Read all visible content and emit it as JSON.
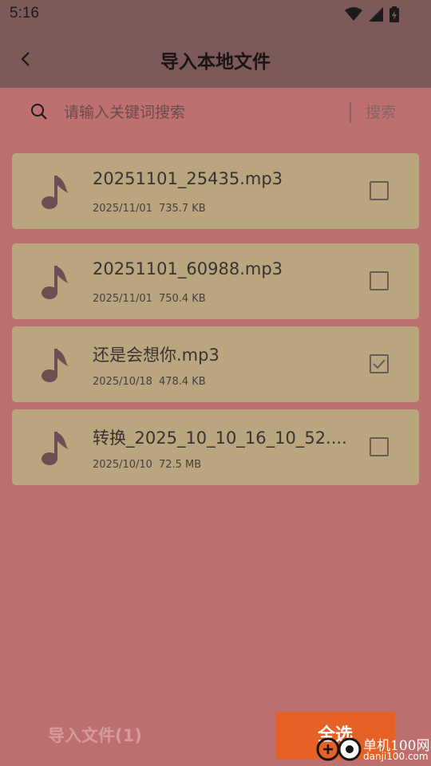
{
  "status_bar": {
    "time": "5:16"
  },
  "header": {
    "title": "导入本地文件"
  },
  "search": {
    "placeholder": "请输入关键词搜索",
    "button_label": "搜索"
  },
  "files": [
    {
      "name": "20251101_25435.mp3",
      "date": "2025/11/01",
      "size": "735.7 KB",
      "checked": false
    },
    {
      "name": "20251101_60988.mp3",
      "date": "2025/11/01",
      "size": "750.4 KB",
      "checked": false
    },
    {
      "name": "还是会想你.mp3",
      "date": "2025/10/18",
      "size": "478.4 KB",
      "checked": true
    },
    {
      "name": "转换_2025_10_10_16_10_52....",
      "date": "2025/10/10",
      "size": "72.5 MB",
      "checked": false
    }
  ],
  "bottom": {
    "import_label": "导入文件(1)",
    "select_all_label": "全选"
  },
  "watermark": {
    "line1": "单机100网",
    "line2": "danji100.com"
  },
  "colors": {
    "background": "#be6f6f",
    "header": "#7c5a5a",
    "card": "#b9a57e",
    "accent": "#e56126"
  },
  "icons": [
    "wifi-icon",
    "signal-icon",
    "battery-icon",
    "back-arrow-icon",
    "search-icon",
    "music-note-icon",
    "checkbox-icon"
  ]
}
